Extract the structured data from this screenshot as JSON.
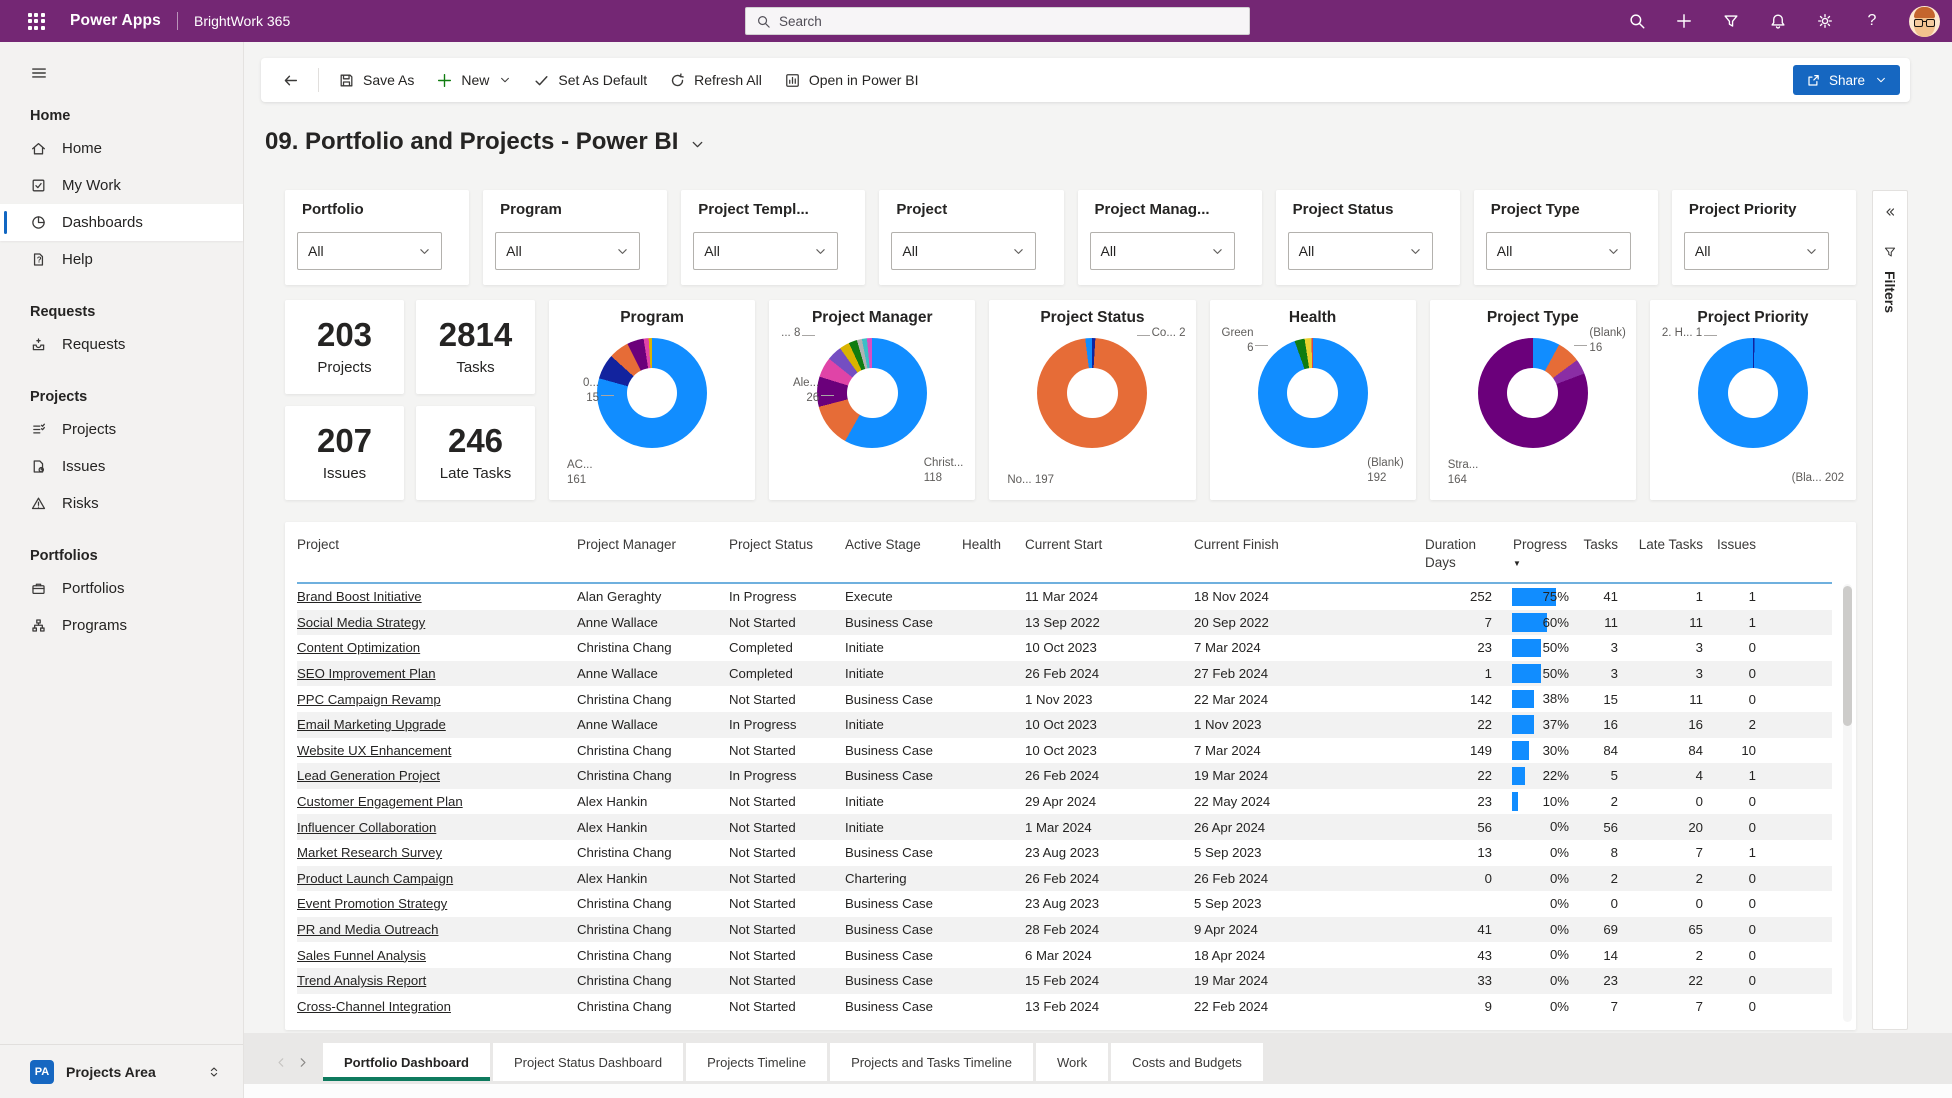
{
  "topbar": {
    "app_name": "Power Apps",
    "environment": "BrightWork 365",
    "search_placeholder": "Search",
    "icons": [
      "search-icon",
      "add-icon",
      "filter-icon",
      "notifications-icon",
      "settings-icon",
      "help-icon",
      "avatar"
    ]
  },
  "sidebar": {
    "groups": [
      {
        "header": "Home",
        "items": [
          {
            "icon": "home-icon",
            "label": "Home",
            "active": false
          },
          {
            "icon": "my-work-icon",
            "label": "My Work",
            "active": false
          },
          {
            "icon": "dashboards-icon",
            "label": "Dashboards",
            "active": true
          },
          {
            "icon": "help-icon",
            "label": "Help",
            "active": false
          }
        ]
      },
      {
        "header": "Requests",
        "items": [
          {
            "icon": "requests-icon",
            "label": "Requests",
            "active": false
          }
        ]
      },
      {
        "header": "Projects",
        "items": [
          {
            "icon": "projects-icon",
            "label": "Projects",
            "active": false
          },
          {
            "icon": "issues-icon",
            "label": "Issues",
            "active": false
          },
          {
            "icon": "risks-icon",
            "label": "Risks",
            "active": false
          }
        ]
      },
      {
        "header": "Portfolios",
        "items": [
          {
            "icon": "portfolios-icon",
            "label": "Portfolios",
            "active": false
          },
          {
            "icon": "programs-icon",
            "label": "Programs",
            "active": false
          }
        ]
      }
    ],
    "footer": {
      "badge": "PA",
      "label": "Projects Area"
    }
  },
  "toolbar": {
    "save_as": "Save As",
    "new_label": "New",
    "set_as_default": "Set As Default",
    "refresh_all": "Refresh All",
    "open_in_power_bi": "Open in Power BI",
    "share": "Share"
  },
  "page": {
    "title": "09. Portfolio and Projects - Power BI"
  },
  "filters": [
    {
      "label": "Portfolio",
      "value": "All"
    },
    {
      "label": "Program",
      "value": "All"
    },
    {
      "label": "Project Templ...",
      "value": "All"
    },
    {
      "label": "Project",
      "value": "All"
    },
    {
      "label": "Project Manag...",
      "value": "All"
    },
    {
      "label": "Project Status",
      "value": "All"
    },
    {
      "label": "Project Type",
      "value": "All"
    },
    {
      "label": "Project Priority",
      "value": "All"
    }
  ],
  "kpis": [
    {
      "value": "203",
      "label": "Projects"
    },
    {
      "value": "2814",
      "label": "Tasks"
    },
    {
      "value": "207",
      "label": "Issues"
    },
    {
      "value": "246",
      "label": "Late Tasks"
    }
  ],
  "chart_data": [
    {
      "type": "donut",
      "title": "Program",
      "total": 203,
      "segments": [
        {
          "label": "AC...",
          "value": 161,
          "color": "#118DFF"
        },
        {
          "label": "0...",
          "value": 15,
          "color": "#12239E"
        },
        {
          "label": "",
          "value": 12,
          "color": "#E66C37"
        },
        {
          "label": "",
          "value": 10,
          "color": "#6B007B"
        },
        {
          "label": "",
          "value": 3,
          "color": "#E044A7"
        },
        {
          "label": "",
          "value": 2,
          "color": "#D9B300"
        }
      ],
      "callouts": [
        {
          "lines": [
            "0...",
            "15"
          ],
          "pos": "l"
        },
        {
          "lines": [
            "AC...",
            "161"
          ],
          "pos": "bl"
        }
      ]
    },
    {
      "type": "donut",
      "title": "Project Manager",
      "total": 203,
      "segments": [
        {
          "label": "Christ...",
          "value": 118,
          "color": "#118DFF"
        },
        {
          "label": "Ale...",
          "value": 26,
          "color": "#E66C37"
        },
        {
          "label": "",
          "value": 18,
          "color": "#6B007B"
        },
        {
          "label": "",
          "value": 12,
          "color": "#E044A7"
        },
        {
          "label": "",
          "value": 9,
          "color": "#744EC2"
        },
        {
          "label": "",
          "value": 6,
          "color": "#D9B300"
        },
        {
          "label": "",
          "value": 5,
          "color": "#107C10"
        },
        {
          "label": "",
          "value": 3,
          "color": "#B3B3B3"
        },
        {
          "label": "",
          "value": 3,
          "color": "#3DBFC7"
        },
        {
          "label": "",
          "value": 3,
          "color": "#DB4DC1"
        }
      ],
      "callouts": [
        {
          "lines": [
            "... 8"
          ],
          "pos": "tl"
        },
        {
          "lines": [
            "Ale...",
            "26"
          ],
          "pos": "l"
        },
        {
          "lines": [
            "Christ...",
            "118"
          ],
          "pos": "br"
        }
      ]
    },
    {
      "type": "donut",
      "title": "Project Status",
      "total": 203,
      "segments": [
        {
          "label": "Co...",
          "value": 2,
          "color": "#12239E"
        },
        {
          "label": "No...",
          "value": 197,
          "color": "#E66C37"
        },
        {
          "label": "",
          "value": 4,
          "color": "#118DFF"
        }
      ],
      "callouts": [
        {
          "lines": [
            "Co... 2"
          ],
          "pos": "tr"
        },
        {
          "lines": [
            "No... 197"
          ],
          "pos": "bl"
        }
      ]
    },
    {
      "type": "donut",
      "title": "Health",
      "total": 203,
      "segments": [
        {
          "label": "(Blank)",
          "value": 192,
          "color": "#118DFF"
        },
        {
          "label": "Green",
          "value": 6,
          "color": "#107C10"
        },
        {
          "label": "",
          "value": 4,
          "color": "#EAD130"
        },
        {
          "label": "",
          "value": 1,
          "color": "#D64550"
        }
      ],
      "callouts": [
        {
          "lines": [
            "Green",
            "6"
          ],
          "pos": "tl"
        },
        {
          "lines": [
            "(Blank)",
            "192"
          ],
          "pos": "br"
        }
      ]
    },
    {
      "type": "donut",
      "title": "Project Type",
      "total": 203,
      "segments": [
        {
          "label": "(Blank)",
          "value": 16,
          "color": "#118DFF"
        },
        {
          "label": "",
          "value": 14,
          "color": "#E66C37"
        },
        {
          "label": "",
          "value": 9,
          "color": "#8A2DA5"
        },
        {
          "label": "Stra...",
          "value": 164,
          "color": "#6B007B"
        }
      ],
      "callouts": [
        {
          "lines": [
            "(Blank)",
            "16"
          ],
          "pos": "tr"
        },
        {
          "lines": [
            "Stra...",
            "164"
          ],
          "pos": "bl"
        }
      ]
    },
    {
      "type": "donut",
      "title": "Project Priority",
      "total": 203,
      "segments": [
        {
          "label": "2. H...",
          "value": 1,
          "color": "#12239E"
        },
        {
          "label": "(Bla...",
          "value": 202,
          "color": "#118DFF"
        }
      ],
      "callouts": [
        {
          "lines": [
            "2. H... 1"
          ],
          "pos": "tl"
        },
        {
          "lines": [
            "(Bla... 202"
          ],
          "pos": "br"
        }
      ]
    }
  ],
  "table": {
    "columns": [
      "Project",
      "Project Manager",
      "Project Status",
      "Active Stage",
      "Health",
      "Current Start",
      "Current Finish",
      "Duration Days",
      "Progress",
      "Tasks",
      "Late Tasks",
      "Issues"
    ],
    "sorted_by": "Progress",
    "rows": [
      [
        "Brand Boost Initiative",
        "Alan Geraghty",
        "In Progress",
        "Execute",
        "",
        "11 Mar 2024",
        "18 Nov 2024",
        "252",
        75,
        "41",
        "1",
        "1"
      ],
      [
        "Social Media Strategy",
        "Anne Wallace",
        "Not Started",
        "Business Case",
        "",
        "13 Sep 2022",
        "20 Sep 2022",
        "7",
        60,
        "11",
        "11",
        "1"
      ],
      [
        "Content Optimization",
        "Christina Chang",
        "Completed",
        "Initiate",
        "",
        "10 Oct 2023",
        "7 Mar 2024",
        "23",
        50,
        "3",
        "3",
        "0"
      ],
      [
        "SEO Improvement Plan",
        "Anne Wallace",
        "Completed",
        "Initiate",
        "",
        "26 Feb 2024",
        "27 Feb 2024",
        "1",
        50,
        "3",
        "3",
        "0"
      ],
      [
        "PPC Campaign Revamp",
        "Christina Chang",
        "Not Started",
        "Business Case",
        "",
        "1 Nov 2023",
        "22 Mar 2024",
        "142",
        38,
        "15",
        "11",
        "0"
      ],
      [
        "Email Marketing Upgrade",
        "Anne Wallace",
        "In Progress",
        "Initiate",
        "",
        "10 Oct 2023",
        "1 Nov 2023",
        "22",
        37,
        "16",
        "16",
        "2"
      ],
      [
        "Website UX Enhancement",
        "Christina Chang",
        "Not Started",
        "Business Case",
        "",
        "10 Oct 2023",
        "7 Mar 2024",
        "149",
        30,
        "84",
        "84",
        "10"
      ],
      [
        "Lead Generation Project",
        "Christina Chang",
        "In Progress",
        "Business Case",
        "",
        "26 Feb 2024",
        "19 Mar 2024",
        "22",
        22,
        "5",
        "4",
        "1"
      ],
      [
        "Customer Engagement Plan",
        "Alex Hankin",
        "Not Started",
        "Initiate",
        "",
        "29 Apr 2024",
        "22 May 2024",
        "23",
        10,
        "2",
        "0",
        "0"
      ],
      [
        "Influencer Collaboration",
        "Alex Hankin",
        "Not Started",
        "Initiate",
        "",
        "1 Mar 2024",
        "26 Apr 2024",
        "56",
        0,
        "56",
        "20",
        "0"
      ],
      [
        "Market Research Survey",
        "Christina Chang",
        "Not Started",
        "Business Case",
        "",
        "23 Aug 2023",
        "5 Sep 2023",
        "13",
        0,
        "8",
        "7",
        "1"
      ],
      [
        "Product Launch Campaign",
        "Alex Hankin",
        "Not Started",
        "Chartering",
        "",
        "26 Feb 2024",
        "26 Feb 2024",
        "0",
        0,
        "2",
        "2",
        "0"
      ],
      [
        "Event Promotion Strategy",
        "Christina Chang",
        "Not Started",
        "Business Case",
        "",
        "23 Aug 2023",
        "5 Sep 2023",
        "",
        0,
        "0",
        "0",
        "0"
      ],
      [
        "PR and Media Outreach",
        "Christina Chang",
        "Not Started",
        "Business Case",
        "",
        "28 Feb 2024",
        "9 Apr 2024",
        "41",
        0,
        "69",
        "65",
        "0"
      ],
      [
        "Sales Funnel Analysis",
        "Christina Chang",
        "Not Started",
        "Business Case",
        "",
        "6 Mar 2024",
        "18 Apr 2024",
        "43",
        0,
        "14",
        "2",
        "0"
      ],
      [
        "Trend Analysis Report",
        "Christina Chang",
        "Not Started",
        "Business Case",
        "",
        "15 Feb 2024",
        "19 Mar 2024",
        "33",
        0,
        "23",
        "22",
        "0"
      ],
      [
        "Cross-Channel Integration",
        "Christina Chang",
        "Not Started",
        "Business Case",
        "",
        "13 Feb 2024",
        "22 Feb 2024",
        "9",
        0,
        "7",
        "7",
        "0"
      ]
    ]
  },
  "tabs": {
    "items": [
      {
        "label": "Portfolio Dashboard",
        "active": true
      },
      {
        "label": "Project Status Dashboard",
        "active": false
      },
      {
        "label": "Projects Timeline",
        "active": false
      },
      {
        "label": "Projects and Tasks Timeline",
        "active": false
      },
      {
        "label": "Work",
        "active": false
      },
      {
        "label": "Costs and Budgets",
        "active": false
      }
    ]
  },
  "filters_pane": {
    "label": "Filters"
  }
}
